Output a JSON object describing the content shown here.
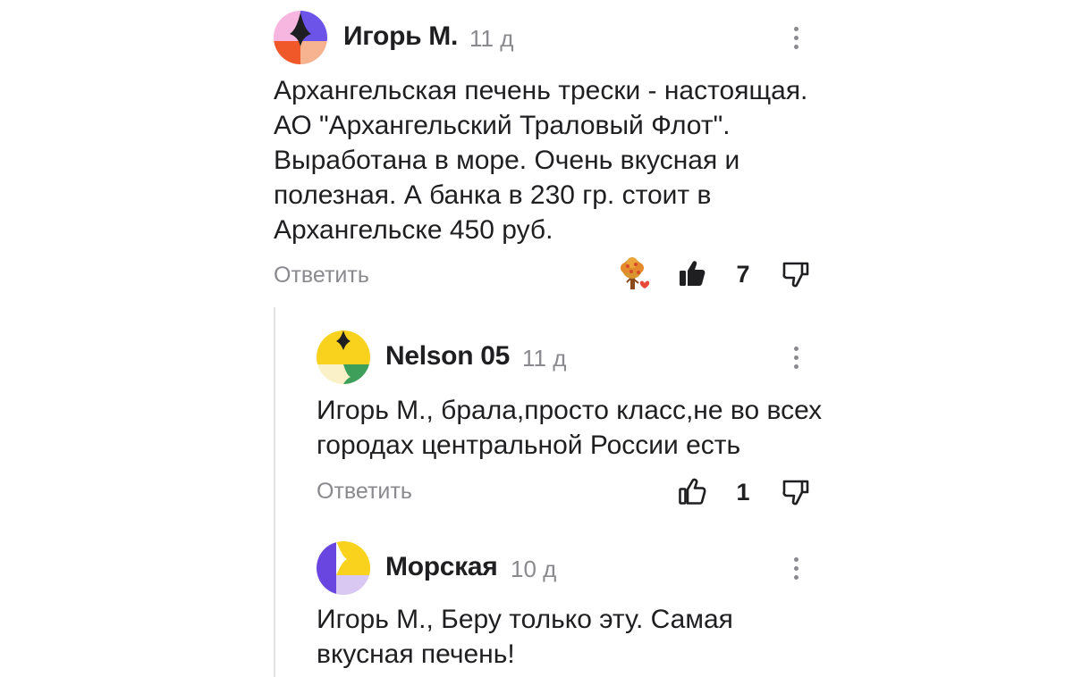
{
  "comments": [
    {
      "author": "Игорь М.",
      "time": "11 д",
      "text": "Архангельская печень трески - настоящая. АО \"Архангельский Траловый Флот\". Выработана в море. Очень вкусная и полезная. А банка в 230 гр. стоит в Архангельске 450 руб.",
      "reply_label": "Ответить",
      "likes": "7",
      "liked": true,
      "avatar_icon": "pink-purple-orange-avatar-icon",
      "reaction_icon": "tree-heart-reaction-icon"
    },
    {
      "author": "Nelson 05",
      "time": "11 д",
      "text": "Игорь М., брала,просто класс,не во всех городах центральной России есть",
      "reply_label": "Ответить",
      "likes": "1",
      "liked": false,
      "avatar_icon": "yellow-green-avatar-icon"
    },
    {
      "author": "Морская",
      "time": "10 д",
      "text": "Игорь М., Беру только эту. Самая вкусная печень!",
      "avatar_icon": "purple-yellow-avatar-icon"
    }
  ],
  "colors": {
    "text": "#1f1f22",
    "muted": "#8a8a8e",
    "thread_line": "#e2e2e5"
  }
}
